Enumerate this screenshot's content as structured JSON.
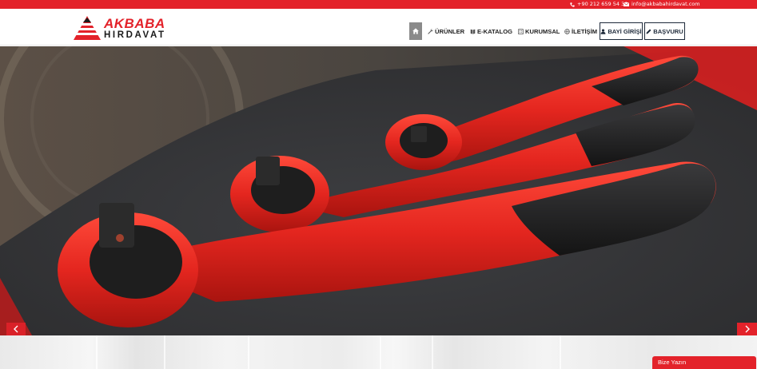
{
  "topbar": {
    "phone": "+90 212 659 54 30",
    "email": "info@akbabahirdavat.com",
    "phone_icon": "phone-icon",
    "email_icon": "envelope-icon",
    "color": "#e3222a"
  },
  "brand": {
    "name_top": "AKBABA",
    "name_bottom": "HIRDAVAT",
    "primary_color": "#e3222a",
    "dark_color": "#1a1a1a"
  },
  "nav": {
    "home_icon": "home-icon",
    "items": [
      {
        "label": "ÜRÜNLER",
        "icon": "wrench-icon"
      },
      {
        "label": "E-KATALOG",
        "icon": "book-icon"
      },
      {
        "label": "KURUMSAL",
        "icon": "building-icon"
      },
      {
        "label": "İLETİŞİM",
        "icon": "globe-icon"
      }
    ],
    "buttons": [
      {
        "label": "BAYİ GİRİŞİ",
        "icon": "user-icon"
      },
      {
        "label": "BAŞVURU",
        "icon": "pencil-icon"
      }
    ]
  },
  "hero": {
    "image_subject": "red ratchet wrenches",
    "prev_icon": "chevron-left-icon",
    "next_icon": "chevron-right-icon"
  },
  "chat": {
    "label": "Bize Yazın"
  }
}
